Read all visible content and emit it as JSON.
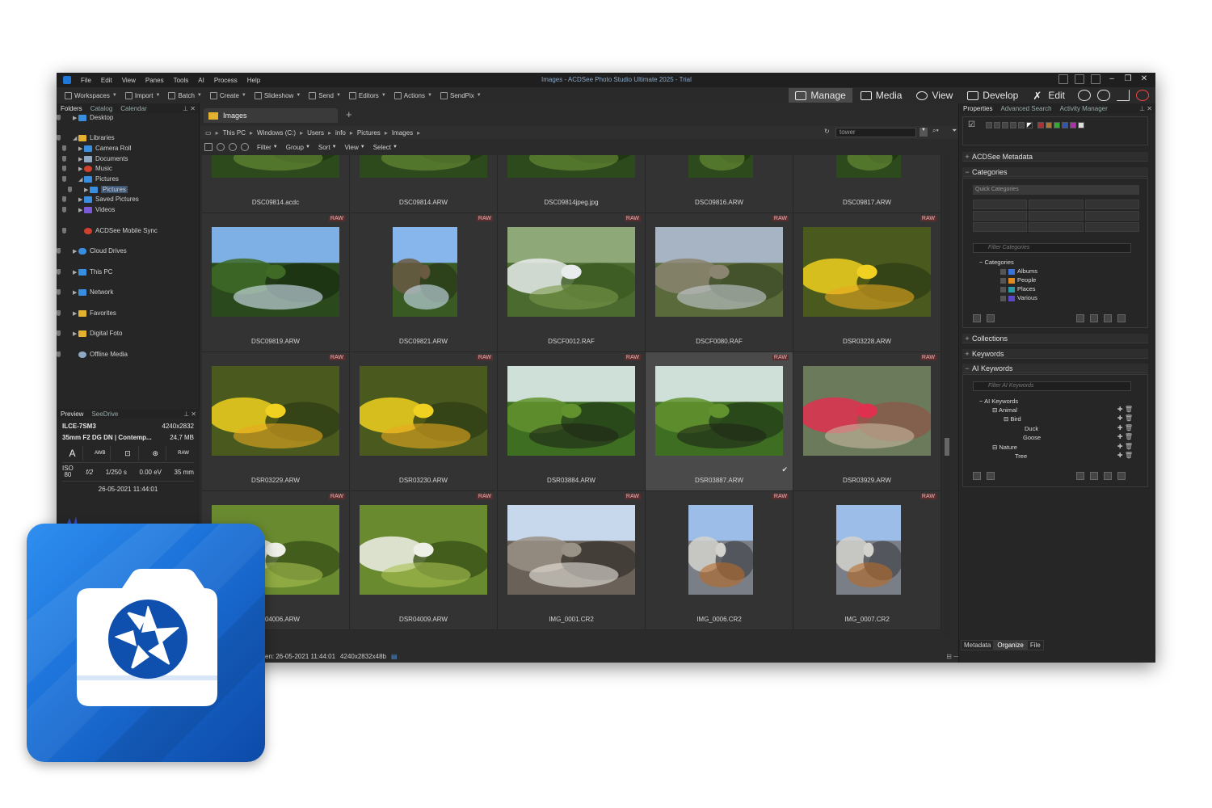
{
  "window": {
    "title": "Images - ACDSee Photo Studio Ultimate 2025 - Trial",
    "menu": [
      "File",
      "Edit",
      "View",
      "Panes",
      "Tools",
      "AI",
      "Process",
      "Help"
    ]
  },
  "toolbar": {
    "items": [
      "Workspaces",
      "Import",
      "Batch",
      "Create",
      "Slideshow",
      "Send",
      "Editors",
      "Actions",
      "SendPix"
    ],
    "modes": [
      "Manage",
      "Media",
      "View",
      "Develop",
      "Edit"
    ],
    "active_mode": "Manage"
  },
  "left_panel": {
    "tabs": [
      "Folders",
      "Catalog",
      "Calendar"
    ],
    "tree": [
      {
        "label": "Desktop",
        "icon": "desktop-icon"
      },
      {
        "label": "Libraries",
        "icon": "folder-icon"
      },
      {
        "label": "Camera Roll",
        "icon": "camera-roll-icon"
      },
      {
        "label": "Documents",
        "icon": "documents-icon"
      },
      {
        "label": "Music",
        "icon": "music-icon"
      },
      {
        "label": "Pictures",
        "icon": "pictures-icon"
      },
      {
        "label": "Pictures",
        "icon": "pictures-icon",
        "selected": true
      },
      {
        "label": "Saved Pictures",
        "icon": "pictures-icon"
      },
      {
        "label": "Videos",
        "icon": "videos-icon"
      },
      {
        "label": "ACDSee Mobile Sync",
        "icon": "mobile-sync-icon"
      },
      {
        "label": "Cloud Drives",
        "icon": "cloud-icon"
      },
      {
        "label": "This PC",
        "icon": "pc-icon"
      },
      {
        "label": "Network",
        "icon": "network-icon"
      },
      {
        "label": "Favorites",
        "icon": "folder-icon"
      },
      {
        "label": "Digital Foto",
        "icon": "folder-icon"
      },
      {
        "label": "Offline Media",
        "icon": "offline-media-icon"
      }
    ],
    "preview_tabs": [
      "Preview",
      "SeeDrive"
    ],
    "preview": {
      "camera": "ILCE-7SM3",
      "resolution": "4240x2832",
      "lens": "35mm F2 DG DN | Contemp...",
      "size": "24,7 MB",
      "exif_icons": [
        "A",
        "AWB",
        "metering",
        "flash",
        "RAW"
      ],
      "iso_label": "ISO",
      "iso": "80",
      "aperture": "f/2",
      "shutter": "1/250 s",
      "ev": "0.00 eV",
      "focal": "35 mm",
      "date": "26-05-2021 11:44:01"
    }
  },
  "center": {
    "doc_tab": "Images",
    "breadcrumb": [
      "This PC",
      "Windows (C:)",
      "Users",
      "info",
      "Pictures",
      "Images"
    ],
    "search_value": "tower",
    "filter_bar": [
      "Filter",
      "Group",
      "Sort",
      "View",
      "Select"
    ],
    "thumbnails": [
      {
        "name": "DSC09814.acdc",
        "raw": false,
        "scene": "garden"
      },
      {
        "name": "DSC09814.ARW",
        "raw": false,
        "scene": "garden"
      },
      {
        "name": "DSC09814jpeg.jpg",
        "raw": false,
        "scene": "garden"
      },
      {
        "name": "DSC09816.ARW",
        "raw": false,
        "scene": "garden-portrait"
      },
      {
        "name": "DSC09817.ARW",
        "raw": false,
        "scene": "garden-portrait"
      },
      {
        "name": "DSC09819.ARW",
        "raw": true,
        "scene": "forest-sky"
      },
      {
        "name": "DSC09821.ARW",
        "raw": true,
        "scene": "path-portrait"
      },
      {
        "name": "DSCF0012.RAF",
        "raw": true,
        "scene": "birch"
      },
      {
        "name": "DSCF0080.RAF",
        "raw": true,
        "scene": "field"
      },
      {
        "name": "DSR03228.ARW",
        "raw": true,
        "scene": "daffodil"
      },
      {
        "name": "DSR03229.ARW",
        "raw": true,
        "scene": "daffodil"
      },
      {
        "name": "DSR03230.ARW",
        "raw": true,
        "scene": "daffodil"
      },
      {
        "name": "DSR03884.ARW",
        "raw": true,
        "scene": "duck-park"
      },
      {
        "name": "DSR03887.ARW",
        "raw": true,
        "scene": "duck-park",
        "selected": true
      },
      {
        "name": "DSR03929.ARW",
        "raw": true,
        "scene": "tulip"
      },
      {
        "name": "DSR04006.ARW",
        "raw": true,
        "scene": "dandelion"
      },
      {
        "name": "DSR04009.ARW",
        "raw": true,
        "scene": "dandelion"
      },
      {
        "name": "IMG_0001.CR2",
        "raw": true,
        "scene": "building"
      },
      {
        "name": "IMG_0006.CR2",
        "raw": true,
        "scene": "tower-portrait"
      },
      {
        "name": "IMG_0007.CR2",
        "raw": true,
        "scene": "tower-portrait"
      }
    ],
    "raw_badge": "RAW",
    "status": [
      "ken: 26-05-2021 11:44:01",
      "4240x2832x48b"
    ]
  },
  "right_panel": {
    "tabs": [
      "Properties",
      "Advanced Search",
      "Activity Manager"
    ],
    "rating_numbers": [
      "1",
      "2",
      "3",
      "4",
      "5"
    ],
    "sections": {
      "acdsee_metadata": "ACDSee Metadata",
      "categories": "Categories",
      "collections": "Collections",
      "keywords": "Keywords",
      "ai_keywords": "AI Keywords"
    },
    "quick_categories": "Quick Categories",
    "filter_categories_placeholder": "Filter Categories",
    "categories_tree": [
      "Categories",
      "Albums",
      "People",
      "Places",
      "Various"
    ],
    "filter_ai_placeholder": "Filter AI Keywords",
    "ai_tree": [
      "AI Keywords",
      "Animal",
      "Bird",
      "Duck",
      "Goose",
      "Nature",
      "Tree"
    ],
    "bottom_tabs": [
      "Metadata",
      "Organize",
      "File"
    ]
  },
  "colors": {
    "accent": "#1e78d8",
    "raw_badge": "#5a2e2e",
    "badge_gradient_start": "#2f8ff0",
    "badge_gradient_end": "#0d4aa8"
  }
}
